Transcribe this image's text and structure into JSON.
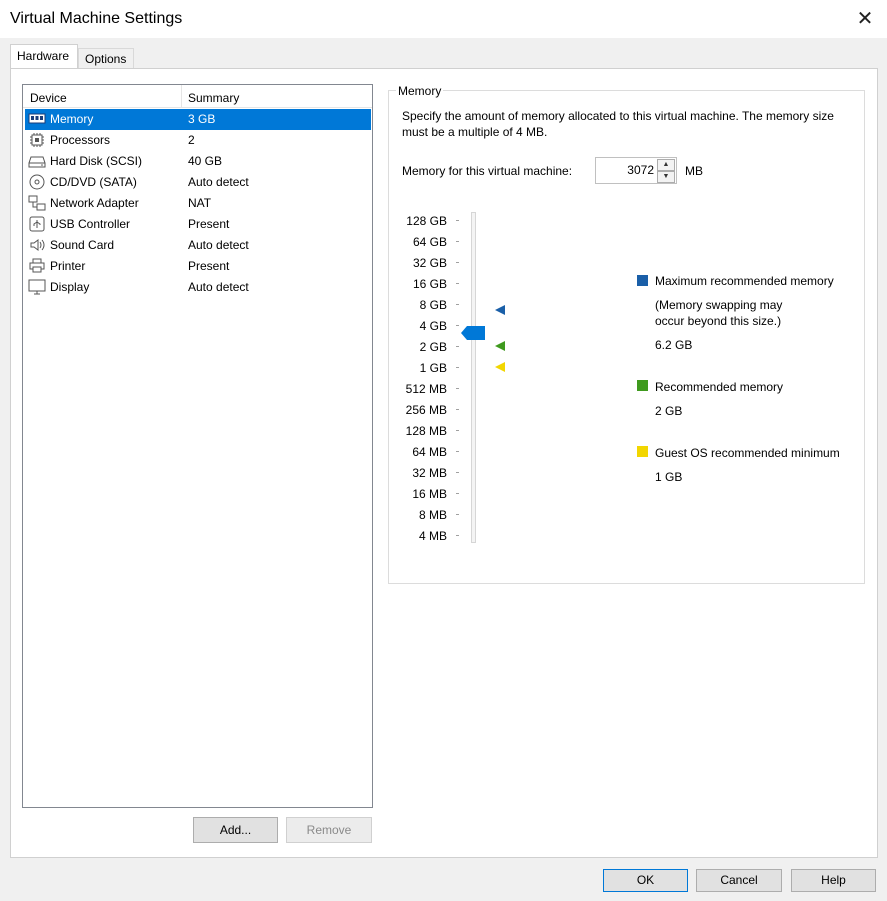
{
  "window": {
    "title": "Virtual Machine Settings"
  },
  "tabs": [
    {
      "label": "Hardware",
      "active": true
    },
    {
      "label": "Options",
      "active": false
    }
  ],
  "device_list": {
    "headers": {
      "device": "Device",
      "summary": "Summary"
    },
    "items": [
      {
        "name": "Memory",
        "summary": "3 GB",
        "icon": "memory-icon",
        "selected": true
      },
      {
        "name": "Processors",
        "summary": "2",
        "icon": "processor-icon"
      },
      {
        "name": "Hard Disk (SCSI)",
        "summary": "40 GB",
        "icon": "hard-disk-icon"
      },
      {
        "name": "CD/DVD (SATA)",
        "summary": "Auto detect",
        "icon": "cd-dvd-icon"
      },
      {
        "name": "Network Adapter",
        "summary": "NAT",
        "icon": "network-adapter-icon"
      },
      {
        "name": "USB Controller",
        "summary": "Present",
        "icon": "usb-icon"
      },
      {
        "name": "Sound Card",
        "summary": "Auto detect",
        "icon": "speaker-icon"
      },
      {
        "name": "Printer",
        "summary": "Present",
        "icon": "printer-icon"
      },
      {
        "name": "Display",
        "summary": "Auto detect",
        "icon": "monitor-icon"
      }
    ]
  },
  "list_buttons": {
    "add": "Add...",
    "remove": "Remove"
  },
  "memory": {
    "group_label": "Memory",
    "description": "Specify the amount of memory allocated to this virtual machine. The memory size must be a multiple of 4 MB.",
    "field_label": "Memory for this virtual machine:",
    "value": "3072",
    "unit": "MB",
    "scale_labels": [
      "128 GB",
      "64 GB",
      "32 GB",
      "16 GB",
      "8 GB",
      "4 GB",
      "2 GB",
      "1 GB",
      "512 MB",
      "256 MB",
      "128 MB",
      "64 MB",
      "32 MB",
      "16 MB",
      "8 MB",
      "4 MB"
    ],
    "legend": {
      "max": {
        "label": "Maximum recommended memory",
        "note": "(Memory swapping may occur beyond this size.)",
        "value": "6.2 GB",
        "color": "#1a5fa8"
      },
      "recommended": {
        "label": "Recommended memory",
        "value": "2 GB",
        "color": "#3f9a1e"
      },
      "guest_min": {
        "label": "Guest OS recommended minimum",
        "value": "1 GB",
        "color": "#f2d600"
      }
    },
    "slider_thumb_color": "#0078d7"
  },
  "dialog_buttons": {
    "ok": "OK",
    "cancel": "Cancel",
    "help": "Help"
  }
}
